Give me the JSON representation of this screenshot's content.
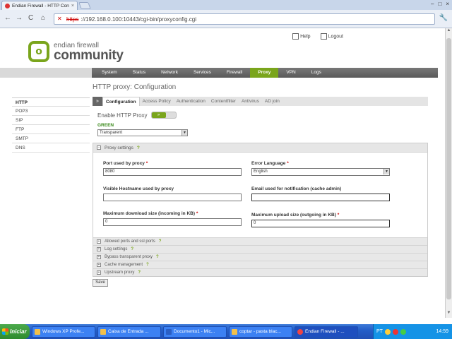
{
  "browser": {
    "tab_title": "Endian Firewall - HTTP Config...",
    "url_scheme": "https",
    "url_rest": "://192.168.0.100:10443/cgi-bin/proxyconfig.cgi"
  },
  "header": {
    "help": "Help",
    "logout": "Logout",
    "logo_line1": "endian firewall",
    "logo_line2": "community"
  },
  "mainnav": [
    "System",
    "Status",
    "Network",
    "Services",
    "Firewall",
    "Proxy",
    "VPN",
    "Logs"
  ],
  "page_title": "HTTP proxy: Configuration",
  "sidebar": [
    "HTTP",
    "POP3",
    "SIP",
    "FTP",
    "SMTP",
    "DNS"
  ],
  "subtabs": [
    "Configuration",
    "Access Policy",
    "Authentication",
    "Contentfilter",
    "Antivirus",
    "AD join"
  ],
  "enable": {
    "label": "Enable HTTP Proxy",
    "toggle": "»"
  },
  "zone": {
    "label": "GREEN",
    "mode": "Transparent"
  },
  "proxy_settings": {
    "title": "Proxy settings",
    "help": "?",
    "port_label": "Port used by proxy",
    "port_value": "8080",
    "error_lang_label": "Error Language",
    "error_lang_value": "English",
    "hostname_label": "Visible Hostname used by proxy",
    "hostname_value": "",
    "email_label": "Email used for notification (cache admin)",
    "email_value": "",
    "maxdown_label": "Maximum download size (incoming in KB)",
    "maxdown_value": "0",
    "maxup_label": "Maximum upload size (outgoing in KB)",
    "maxup_value": "0",
    "required": "*"
  },
  "collapsed_sections": [
    "Allowed ports and ssl ports",
    "Log settings",
    "Bypass transparent proxy",
    "Cache management",
    "Upstream proxy"
  ],
  "save_label": "Save",
  "taskbar": {
    "start": "Iniciar",
    "tasks": [
      "Windows XP Profe...",
      "Caixa de Entrada ...",
      "Documento1 - Mic...",
      "coptar - pasta blac...",
      "Endian Firewall - ..."
    ],
    "tray_lang": "PT",
    "time": "14:59"
  }
}
